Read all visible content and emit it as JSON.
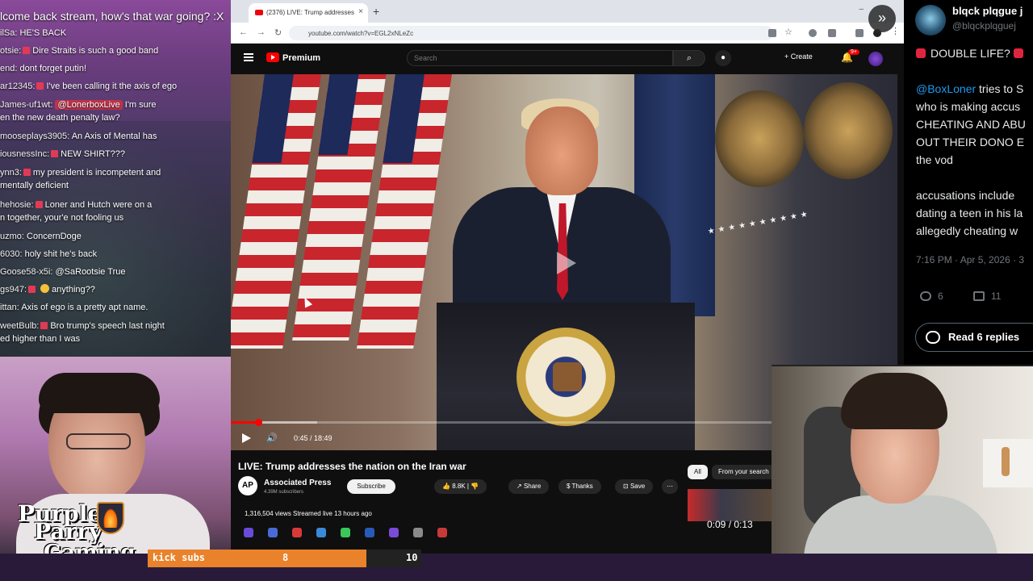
{
  "chat": {
    "title": "lcome back stream, how's that war going? :X",
    "lines": [
      {
        "user": "ilSa:",
        "text": "HE'S BACK",
        "badge": false
      },
      {
        "user": "otsie:",
        "text": "Dire Straits is such a good band",
        "badge": true
      },
      {
        "user": "end:",
        "text": "dont forget putin!",
        "badge": false
      },
      {
        "user": "ar12345:",
        "text": "I've been calling it the axis of ego",
        "badge": true
      },
      {
        "user": "James-uf1wt:",
        "mention": "@LonerboxLive",
        "text": "I'm sure",
        "text2": "en the new death penalty law?",
        "badge": false
      },
      {
        "user": "mooseplays3905:",
        "text": "An Axis of Mental has",
        "badge": false
      },
      {
        "user": "iousnessInc:",
        "text": "NEW SHIRT???",
        "badge": true
      },
      {
        "user": "ynn3:",
        "text": "my president is incompetent and",
        "text2": "mentally deficient",
        "badge": true
      },
      {
        "user": "hehosie:",
        "text": "Loner and Hutch were on a",
        "text2": "n together, your'e not fooling us",
        "badge": true
      },
      {
        "user": "uzmo:",
        "text": "ConcernDoge",
        "badge": false
      },
      {
        "user": "6030:",
        "text": "holy shit he's back",
        "badge": false
      },
      {
        "user": "Goose58-x5i:",
        "text": "@SaRootsie True",
        "badge": false
      },
      {
        "user": "gs947:",
        "text": "anything??",
        "badge": true,
        "emoji": true
      },
      {
        "user": "ittan:",
        "text": "Axis of ego is a pretty apt name.",
        "badge": false
      },
      {
        "user": "weetBulb:",
        "text": "Bro trump's speech last night",
        "text2": "ed higher than I was",
        "badge": true
      }
    ]
  },
  "logo": {
    "line1": "Purple",
    "line2": "Parry",
    "line3": "Gaming"
  },
  "browser": {
    "tab_title": "(2376) LIVE: Trump addresses",
    "url": "youtube.com/watch?v=EGL2xNLeZc",
    "new_tab": "+",
    "close": "×",
    "win_min": "–"
  },
  "youtube": {
    "premium": "Premium",
    "search_placeholder": "Search",
    "create": "+ Create",
    "notif_count": "9+",
    "time": "0:45 / 18:49",
    "title": "LIVE: Trump addresses the nation on the Iran war",
    "channel": "Associated Press",
    "channel_initials": "AP",
    "subs": "4.39M subscribers",
    "subscribe": "Subscribe",
    "likes": "8.8K",
    "share": "Share",
    "thanks": "Thanks",
    "save": "Save",
    "more": "⋯",
    "chip_all": "All",
    "chip_search": "From your search",
    "views": "1,316,504 views  Streamed live 13 hours ago",
    "short_time": "0:09 / 0:13",
    "progress_fraction": 0.041,
    "buffer_fraction": 0.13
  },
  "tweet": {
    "name": "blqck plqgue j",
    "handle": "@blqckplqguej",
    "line1": "DOUBLE LIFE?",
    "line2_link": "@BoxLoner",
    "line2": " tries to S",
    "line3": "who is making accus",
    "line4": "CHEATING AND ABU",
    "line5": "OUT THEIR DONO E",
    "line6": "the vod",
    "line7": "accusations include",
    "line8": "dating a teen in his la",
    "line9": "allegedly cheating w",
    "date": "7:16 PM · Apr 5, 2026 · 3",
    "replies": "6",
    "retweets": "11",
    "read_replies": "Read 6 replies"
  },
  "subs_goal": {
    "label": "kick subs",
    "current": "8",
    "goal": "10",
    "current_value": 8,
    "goal_value": 10
  },
  "colors": {
    "accent_red": "#ff0000",
    "subs_orange": "#e9822a",
    "twitter_link": "#1d9bf0"
  }
}
